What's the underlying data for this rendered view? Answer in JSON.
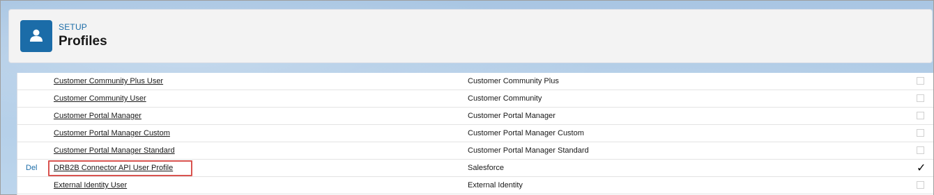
{
  "header": {
    "eyebrow": "SETUP",
    "title": "Profiles",
    "icon": "user-icon"
  },
  "profiles": [
    {
      "del": "",
      "name": "Customer Community Plus User",
      "license": "Customer Community Plus",
      "custom": false
    },
    {
      "del": "",
      "name": "Customer Community User",
      "license": "Customer Community",
      "custom": false
    },
    {
      "del": "",
      "name": "Customer Portal Manager",
      "license": "Customer Portal Manager",
      "custom": false
    },
    {
      "del": "",
      "name": "Customer Portal Manager Custom",
      "license": "Customer Portal Manager Custom",
      "custom": false
    },
    {
      "del": "",
      "name": "Customer Portal Manager Standard",
      "license": "Customer Portal Manager Standard",
      "custom": false
    },
    {
      "del": "Del",
      "name": "DRB2B Connector API User Profile",
      "license": "Salesforce",
      "custom": true
    },
    {
      "del": "",
      "name": "External Identity User",
      "license": "External Identity",
      "custom": false
    }
  ],
  "colors": {
    "brand": "#1b6ca8",
    "highlight": "#d9534f"
  }
}
